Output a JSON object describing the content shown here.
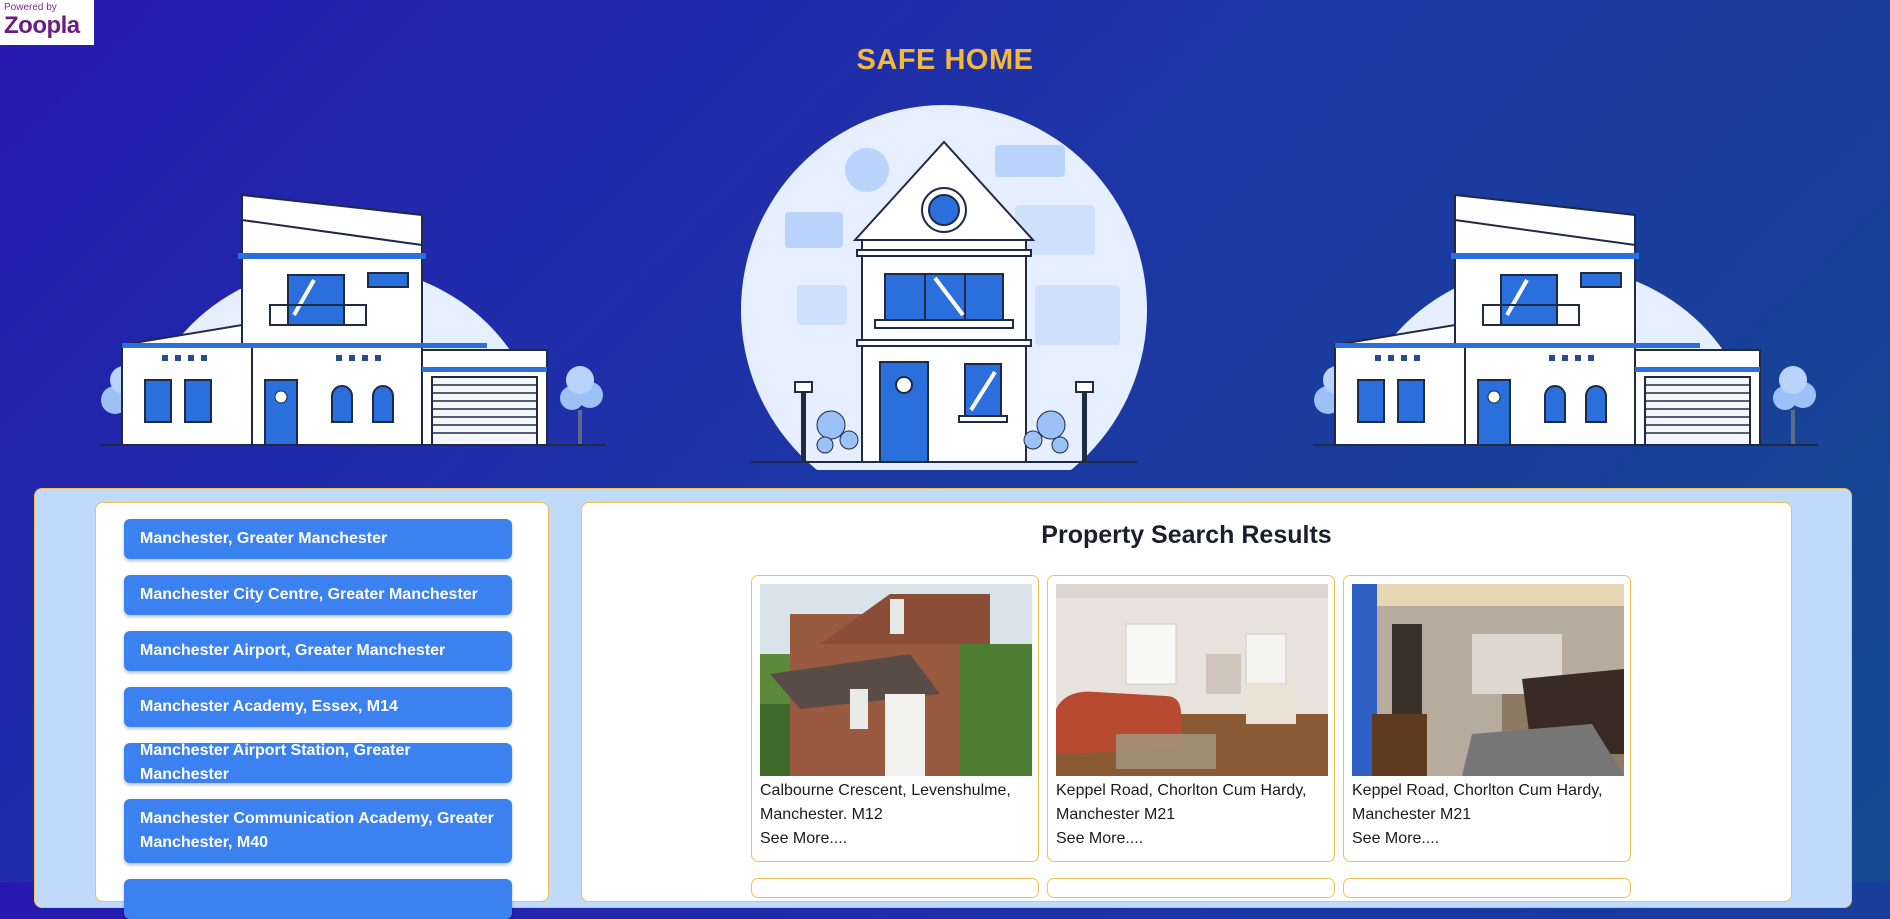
{
  "logo": {
    "powered": "Powered by",
    "brand": "Zoopla"
  },
  "header": {
    "title": "SAFE HOME"
  },
  "locations": [
    "Manchester, Greater Manchester",
    "Manchester City Centre, Greater Manchester",
    "Manchester Airport, Greater Manchester",
    "Manchester Academy, Essex, M14",
    "Manchester Airport Station, Greater Manchester",
    "Manchester Communication Academy, Greater Manchester, M40"
  ],
  "results": {
    "title": "Property Search Results",
    "cards": [
      {
        "address": "Calbourne Crescent, Levenshulme, Manchester. M12",
        "more": "See More...."
      },
      {
        "address": "Keppel Road, Chorlton Cum Hardy, Manchester M21",
        "more": "See More...."
      },
      {
        "address": "Keppel Road, Chorlton Cum Hardy, Manchester M21",
        "more": "See More...."
      }
    ]
  },
  "colors": {
    "title": "#f5b93a",
    "button": "#3b82f0",
    "panel": "#c0dafb",
    "border": "#f0c350"
  }
}
